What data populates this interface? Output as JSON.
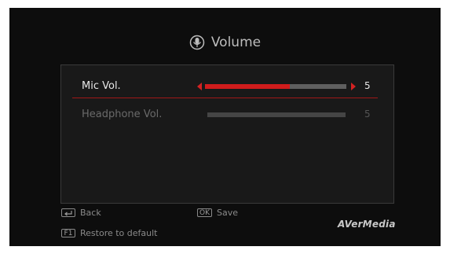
{
  "header": {
    "title": "Volume",
    "icon": "microphone-icon"
  },
  "controls": [
    {
      "label": "Mic Vol.",
      "value": "5",
      "level": 0.6,
      "selected": true
    },
    {
      "label": "Headphone Vol.",
      "value": "5",
      "level": 0,
      "selected": false
    }
  ],
  "footer": {
    "back": {
      "key_icon": "back-arrow-icon",
      "label": "Back"
    },
    "save": {
      "key": "OK",
      "label": "Save"
    },
    "restore": {
      "key": "F1",
      "label": "Restore to default"
    }
  },
  "brand": "AVerMedia",
  "colors": {
    "accent": "#d01c1c",
    "track": "#5f5f5f",
    "background": "#0d0d0d",
    "panel": "#191919"
  }
}
